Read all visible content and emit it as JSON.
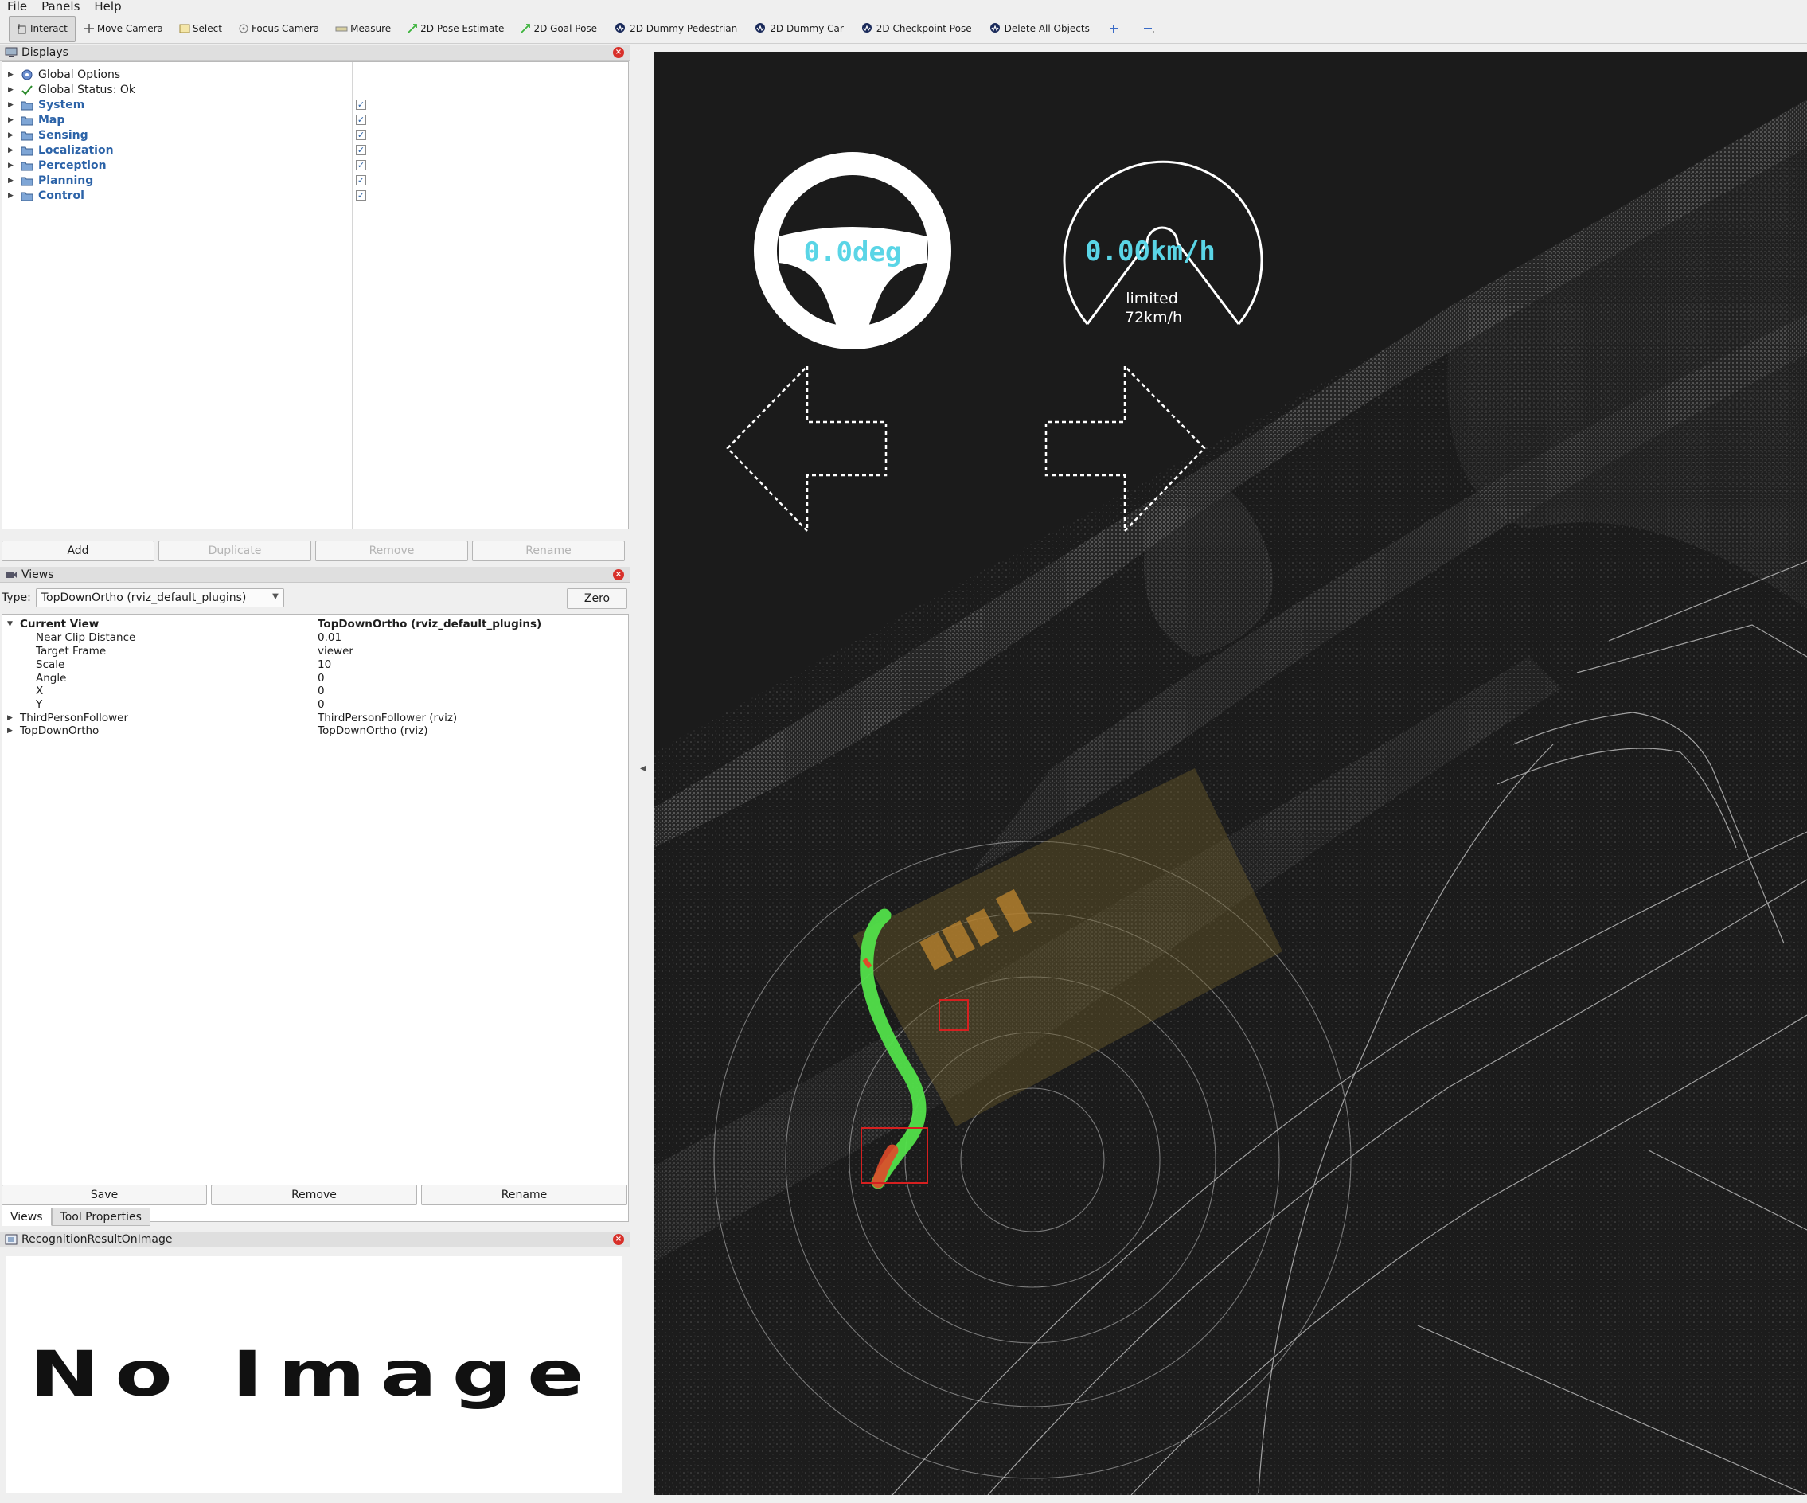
{
  "menu": [
    "File",
    "Panels",
    "Help"
  ],
  "toolbar": {
    "interact": "Interact",
    "move_camera": "Move Camera",
    "select": "Select",
    "focus_camera": "Focus Camera",
    "measure": "Measure",
    "pose_estimate": "2D Pose Estimate",
    "goal_pose": "2D Goal Pose",
    "dummy_pedestrian": "2D Dummy Pedestrian",
    "dummy_car": "2D Dummy Car",
    "checkpoint_pose": "2D Checkpoint Pose",
    "delete_all": "Delete All Objects"
  },
  "displays": {
    "title": "Displays",
    "global_options": "Global Options",
    "global_status": "Global Status: Ok",
    "folders": [
      "System",
      "Map",
      "Sensing",
      "Localization",
      "Perception",
      "Planning",
      "Control"
    ],
    "buttons": {
      "add": "Add",
      "duplicate": "Duplicate",
      "remove": "Remove",
      "rename": "Rename"
    }
  },
  "views": {
    "title": "Views",
    "type_label": "Type:",
    "type_value": "TopDownOrtho (rviz_default_plugins)",
    "zero": "Zero",
    "current_view": {
      "key": "Current View",
      "value": "TopDownOrtho (rviz_default_plugins)"
    },
    "props": [
      {
        "key": "Near Clip Distance",
        "value": "0.01"
      },
      {
        "key": "Target Frame",
        "value": "viewer"
      },
      {
        "key": "Scale",
        "value": "10"
      },
      {
        "key": "Angle",
        "value": "0"
      },
      {
        "key": "X",
        "value": "0"
      },
      {
        "key": "Y",
        "value": "0"
      }
    ],
    "saved": [
      {
        "key": "ThirdPersonFollower",
        "value": "ThirdPersonFollower (rviz)"
      },
      {
        "key": "TopDownOrtho",
        "value": "TopDownOrtho (rviz)"
      }
    ],
    "buttons": {
      "save": "Save",
      "remove": "Remove",
      "rename": "Rename"
    }
  },
  "tabs": [
    "Views",
    "Tool Properties"
  ],
  "recognition": {
    "title": "RecognitionResultOnImage",
    "no_image": "No Image"
  },
  "hud": {
    "steering": "0.0deg",
    "speed": "0.00km/h",
    "limit_line1": "limited",
    "limit_line2": "72km/h"
  },
  "colors": {
    "hud_text": "#5ad5e6",
    "trajectory": "#52e04a",
    "object_box": "#d62020",
    "drivable_area": "#6b5a2a"
  }
}
